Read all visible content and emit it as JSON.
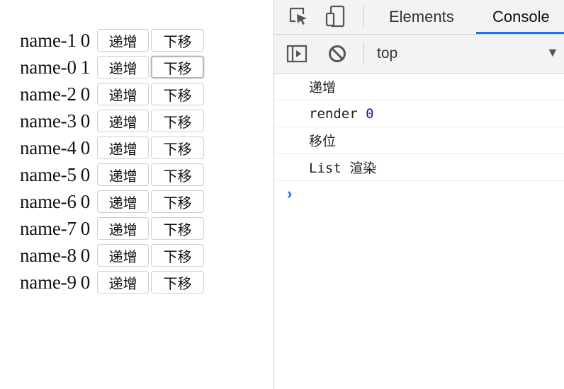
{
  "app": {
    "rows": [
      {
        "name": "name-1",
        "count": "0"
      },
      {
        "name": "name-0",
        "count": "1"
      },
      {
        "name": "name-2",
        "count": "0"
      },
      {
        "name": "name-3",
        "count": "0"
      },
      {
        "name": "name-4",
        "count": "0"
      },
      {
        "name": "name-5",
        "count": "0"
      },
      {
        "name": "name-6",
        "count": "0"
      },
      {
        "name": "name-7",
        "count": "0"
      },
      {
        "name": "name-8",
        "count": "0"
      },
      {
        "name": "name-9",
        "count": "0"
      }
    ],
    "increment_label": "递增",
    "move_down_label": "下移"
  },
  "devtools": {
    "tabs": [
      {
        "label": "Elements",
        "active": false
      },
      {
        "label": "Console",
        "active": true
      }
    ],
    "context_value": "top",
    "icons": {
      "inspect": "inspect-element-icon",
      "device": "device-toolbar-icon",
      "sidebar": "show-sidebar-icon",
      "clear": "clear-console-icon",
      "dropdown": "chevron-down-icon",
      "prompt": "console-prompt-icon"
    },
    "accent_color": "#1a73e8",
    "console_logs": [
      {
        "text": "递增",
        "num": ""
      },
      {
        "text": "render ",
        "num": "0"
      },
      {
        "text": "移位",
        "num": ""
      },
      {
        "text": "List 渲染",
        "num": ""
      }
    ],
    "prompt_symbol": "›"
  }
}
